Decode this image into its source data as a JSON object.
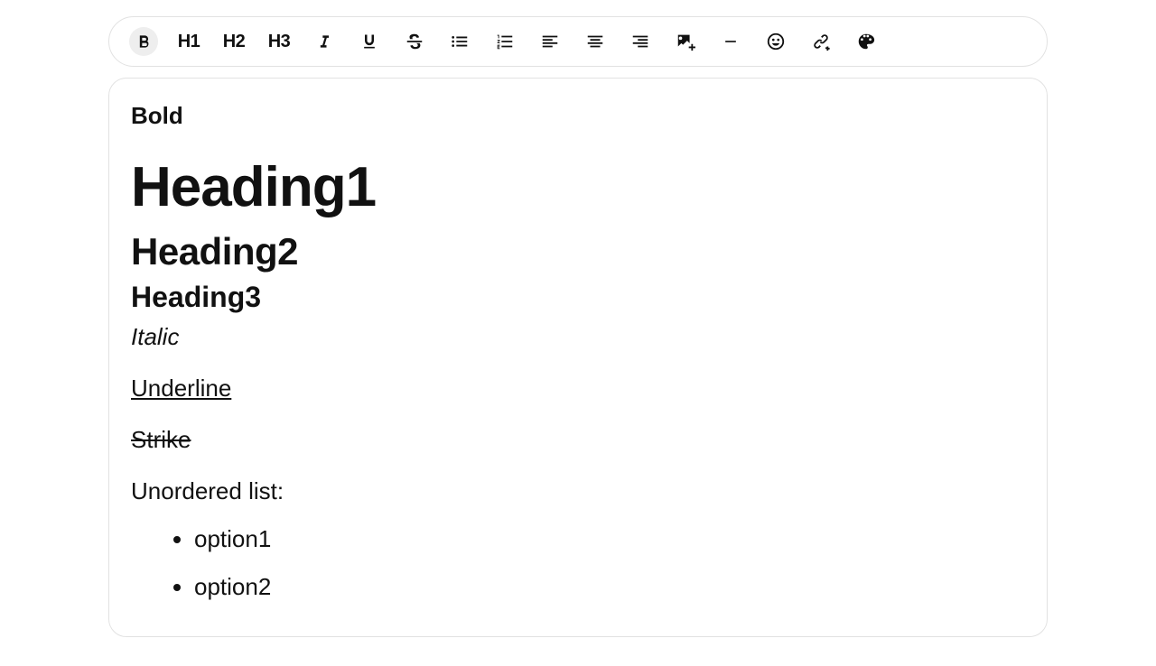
{
  "toolbar": {
    "h1": "H1",
    "h2": "H2",
    "h3": "H3"
  },
  "content": {
    "bold": "Bold",
    "h1": "Heading1",
    "h2": "Heading2",
    "h3": "Heading3",
    "italic": "Italic",
    "underline": "Underline",
    "strike": "Strike",
    "ul_label": "Unordered list:",
    "ul_items": [
      "option1",
      "option2"
    ]
  }
}
